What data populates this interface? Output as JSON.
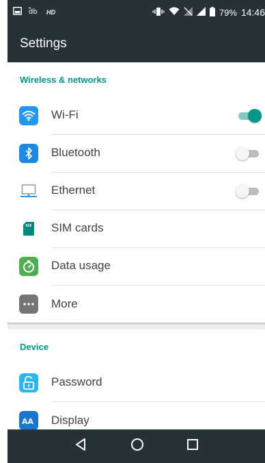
{
  "status_bar": {
    "hd_label": "HD",
    "battery_percent": "79%",
    "time": "14:46"
  },
  "app_bar": {
    "title": "Settings"
  },
  "sections": [
    {
      "header": "Wireless & networks",
      "items": [
        {
          "label": "Wi-Fi",
          "icon": "wifi-icon",
          "toggle": true
        },
        {
          "label": "Bluetooth",
          "icon": "bluetooth-icon",
          "toggle": false
        },
        {
          "label": "Ethernet",
          "icon": "ethernet-icon",
          "toggle": false
        },
        {
          "label": "SIM cards",
          "icon": "sim-card-icon"
        },
        {
          "label": "Data usage",
          "icon": "data-usage-icon"
        },
        {
          "label": "More",
          "icon": "more-icon"
        }
      ]
    },
    {
      "header": "Device",
      "items": [
        {
          "label": "Password",
          "icon": "lock-icon"
        },
        {
          "label": "Display",
          "icon": "display-icon"
        }
      ]
    }
  ],
  "nav_bar": {
    "buttons": [
      "back-icon",
      "home-icon",
      "recents-icon"
    ]
  },
  "colors": {
    "bar_background": "#263238",
    "accent": "#009688",
    "wifi_icon": "#2196F3",
    "bluetooth_icon": "#1E88E5",
    "sim_icon": "#00897B",
    "data_usage_icon": "#4CAF50",
    "more_icon": "#757575",
    "password_icon": "#29B6F6",
    "display_icon": "#1976D2"
  }
}
